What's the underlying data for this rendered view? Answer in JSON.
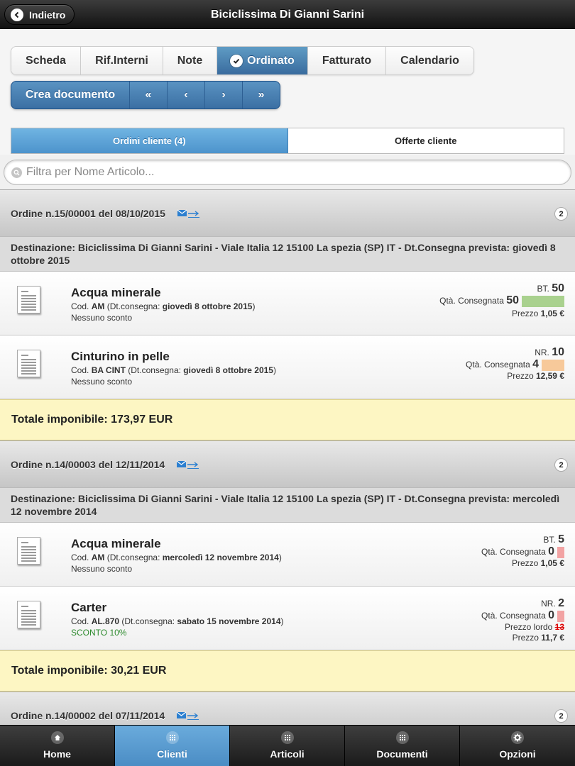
{
  "header": {
    "back_label": "Indietro",
    "title": "Biciclissima Di Gianni Sarini"
  },
  "tabs": [
    {
      "label": "Scheda"
    },
    {
      "label": "Rif.Interni"
    },
    {
      "label": "Note"
    },
    {
      "label": "Ordinato"
    },
    {
      "label": "Fatturato"
    },
    {
      "label": "Calendario"
    }
  ],
  "actions": {
    "create_label": "Crea documento",
    "first": "«",
    "prev": "‹",
    "next": "›",
    "last": "»"
  },
  "segment": {
    "orders_label": "Ordini cliente  (4)",
    "offers_label": "Offerte cliente"
  },
  "filter": {
    "placeholder": "Filtra per Nome Articolo..."
  },
  "orders": [
    {
      "title": "Ordine n.15/00001 del 08/10/2015",
      "count": "2",
      "destination": "Destinazione: Biciclissima Di Gianni Sarini - Viale Italia 12 15100 La spezia (SP) IT - Dt.Consegna prevista: giovedì 8 ottobre 2015",
      "items": [
        {
          "name": "Acqua minerale",
          "cod_prefix": "Cod. ",
          "code": "AM",
          "dt_prefix": "  (Dt.consegna: ",
          "date": "giovedì 8 ottobre 2015",
          "dt_suffix": ")",
          "discount": "Nessuno sconto",
          "unit": "BT. ",
          "qty": "50",
          "delivered_label": "Qtà. Consegnata ",
          "delivered": "50",
          "price_label": "Prezzo ",
          "price": "1,05 €"
        },
        {
          "name": "Cinturino in pelle",
          "cod_prefix": "Cod. ",
          "code": "BA CINT",
          "dt_prefix": "  (Dt.consegna: ",
          "date": "giovedì 8 ottobre 2015",
          "dt_suffix": ")",
          "discount": "Nessuno sconto",
          "unit": "NR. ",
          "qty": "10",
          "delivered_label": "Qtà. Consegnata ",
          "delivered": "4",
          "price_label": "Prezzo ",
          "price": "12,59 €"
        }
      ],
      "total": "Totale imponibile: 173,97 EUR"
    },
    {
      "title": "Ordine n.14/00003 del 12/11/2014",
      "count": "2",
      "destination": "Destinazione: Biciclissima Di Gianni Sarini - Viale Italia 12 15100 La spezia (SP) IT - Dt.Consegna prevista: mercoledì 12 novembre 2014",
      "items": [
        {
          "name": "Acqua minerale",
          "cod_prefix": "Cod. ",
          "code": "AM",
          "dt_prefix": "  (Dt.consegna: ",
          "date": "mercoledì 12 novembre 2014",
          "dt_suffix": ")",
          "discount": "Nessuno sconto",
          "unit": "BT. ",
          "qty": "5",
          "delivered_label": "Qtà. Consegnata ",
          "delivered": "0",
          "price_label": "Prezzo ",
          "price": "1,05 €"
        },
        {
          "name": "Carter",
          "cod_prefix": "Cod. ",
          "code": "AL.870",
          "dt_prefix": "  (Dt.consegna: ",
          "date": "sabato 15 novembre 2014",
          "dt_suffix": ")",
          "discount": "SCONTO 10%",
          "unit": "NR. ",
          "qty": "2",
          "delivered_label": "Qtà. Consegnata ",
          "delivered": "0",
          "gross_label": "Prezzo lordo ",
          "gross": "13",
          "price_label": "Prezzo ",
          "price": "11,7 €"
        }
      ],
      "total": "Totale imponibile: 30,21 EUR"
    },
    {
      "title": "Ordine n.14/00002 del 07/11/2014",
      "count": "2"
    }
  ],
  "footer": [
    {
      "label": "Home",
      "icon": "home-icon"
    },
    {
      "label": "Clienti",
      "icon": "grid-icon"
    },
    {
      "label": "Articoli",
      "icon": "grid-icon"
    },
    {
      "label": "Documenti",
      "icon": "grid-icon"
    },
    {
      "label": "Opzioni",
      "icon": "gear-icon"
    }
  ],
  "colors": {
    "accent": "#4a8cc4",
    "delivered_full": "#a9d18e",
    "delivered_partial": "#f7c99a",
    "delivered_none": "#f2a3a3",
    "discount_green": "#2e8b2e",
    "total_bg": "#fdf6c3"
  }
}
